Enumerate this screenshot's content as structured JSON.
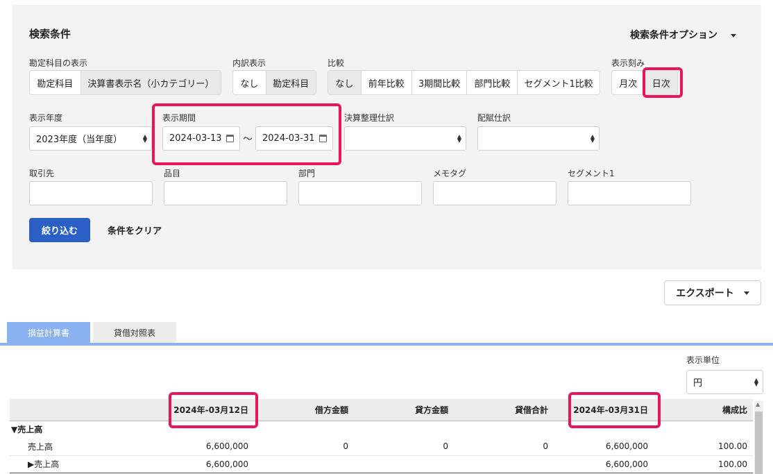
{
  "search": {
    "title": "検索条件",
    "options_label": "検索条件オプション",
    "account_display": {
      "label": "勘定科目の表示",
      "options": [
        "勘定科目",
        "決算書表示名（小カテゴリー）"
      ],
      "selected": 1
    },
    "breakdown": {
      "label": "内訳表示",
      "options": [
        "なし",
        "勘定科目"
      ],
      "selected": 1
    },
    "compare": {
      "label": "比較",
      "options": [
        "なし",
        "前年比較",
        "3期間比較",
        "部門比較",
        "セグメント1比較"
      ],
      "selected": 0
    },
    "granularity": {
      "label": "表示刻み",
      "options": [
        "月次",
        "日次"
      ],
      "selected": 1
    },
    "fiscal_year": {
      "label": "表示年度",
      "value": "2023年度（当年度）"
    },
    "period": {
      "label": "表示期間",
      "start": "2024-03-13",
      "sep": "〜",
      "end": "2024-03-31"
    },
    "closing_entry": {
      "label": "決算整理仕訳",
      "value": ""
    },
    "allocation_entry": {
      "label": "配賦仕訳",
      "value": ""
    },
    "partner": {
      "label": "取引先",
      "value": ""
    },
    "item": {
      "label": "品目",
      "value": ""
    },
    "department": {
      "label": "部門",
      "value": ""
    },
    "memo_tag": {
      "label": "メモタグ",
      "value": ""
    },
    "segment1": {
      "label": "セグメント1",
      "value": ""
    },
    "filter_button": "絞り込む",
    "clear_button": "条件をクリア"
  },
  "export_label": "エクスポート",
  "tabs": [
    {
      "label": "損益計算書",
      "active": true
    },
    {
      "label": "貸借対照表",
      "active": false
    }
  ],
  "unit": {
    "label": "表示単位",
    "value": "円"
  },
  "colors": {
    "accent": "#2a5fc5",
    "highlight": "#e8155e",
    "tab_active": "#8ab1f0"
  },
  "table": {
    "headers": [
      "",
      "2024年-03月12日",
      "借方金額",
      "貸方金額",
      "貸借合計",
      "2024年-03月31日",
      "構成比"
    ],
    "section": "▼売上高",
    "rows": [
      {
        "name": "売上高",
        "opening": "6,600,000",
        "debit": "0",
        "credit": "0",
        "net": "0",
        "closing": "6,600,000",
        "ratio": "100.00",
        "link": false
      },
      {
        "name": "▶売上高",
        "opening": "6,600,000",
        "debit": "",
        "credit": "",
        "net": "",
        "closing": "6,600,000",
        "ratio": "100.00",
        "link": true
      }
    ]
  }
}
